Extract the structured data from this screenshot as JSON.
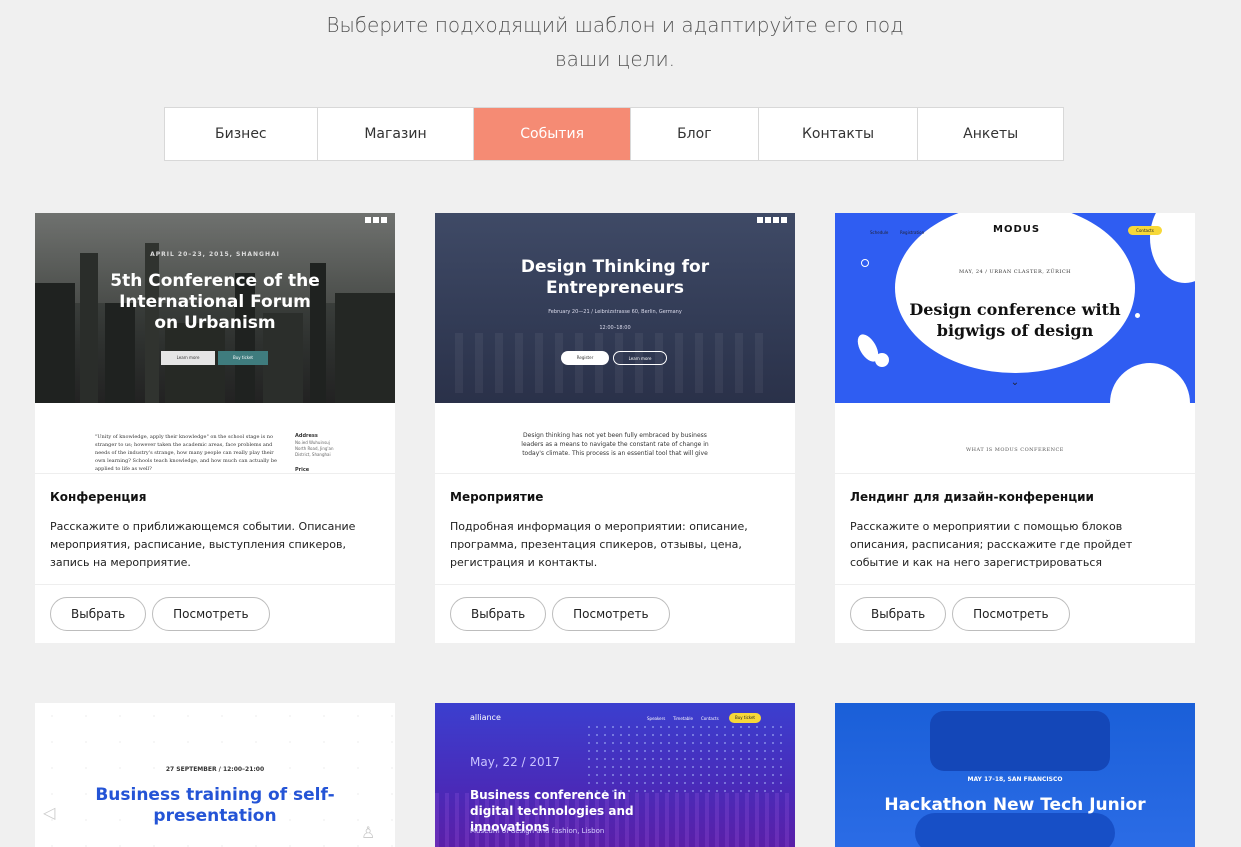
{
  "intro": {
    "line1": "Выберите подходящий шаблон и адаптируйте его под",
    "line2": "ваши цели."
  },
  "tabs": [
    {
      "label": "Бизнес",
      "active": false
    },
    {
      "label": "Магазин",
      "active": false
    },
    {
      "label": "События",
      "active": true
    },
    {
      "label": "Блог",
      "active": false
    },
    {
      "label": "Контакты",
      "active": false
    },
    {
      "label": "Анкеты",
      "active": false
    }
  ],
  "colors": {
    "accent": "#f58b74",
    "page_bg": "#f0f0f0",
    "modus_blue": "#2f5df2"
  },
  "cards": [
    {
      "title": "Конференция",
      "description": "Расскажите о приближающемся событии. Описание мероприятия, расписание, выступления спикеров, запись на мероприятие.",
      "select_label": "Выбрать",
      "view_label": "Посмотреть",
      "preview": {
        "date": "APRIL 20–23, 2015, SHANGHAI",
        "heading": "5th Conference of the International Forum on Urbanism",
        "btn1": "Learn more",
        "btn2": "Buy ticket",
        "quote": "\"Unity of knowledge, apply their knowledge\" on the school stage is no stranger to us; however taken the academic areas, face problems and needs of the industry's strange, how many people can really play their own learning? Schools teach knowledge, and how much can actually be applied to life as well?",
        "address_label": "Address",
        "address": "No.ied Wuhuinsuj North Road, Jing'an District, Shanghai",
        "price_label": "Price"
      }
    },
    {
      "title": "Мероприятие",
      "description": "Подробная информация о мероприятии: описание, программа, презентация спикеров, отзывы, цена, регистрация и контакты.",
      "select_label": "Выбрать",
      "view_label": "Посмотреть",
      "preview": {
        "heading": "Design Thinking for Entrepreneurs",
        "date": "February 20—21 / Leibnizstrasse 60, Berlin, Germany",
        "time": "12:00–18:00",
        "btn1": "Register",
        "btn2": "Learn more",
        "text": "Design thinking has not yet been fully embraced by business leaders as a means to navigate the constant rate of change in today's climate. This process is an essential tool that will give"
      }
    },
    {
      "title": "Лендинг для дизайн-конференции",
      "description": "Расскажите о мероприятии с помощью блоков описания, расписания; расскажите где пройдет событие и как на него зарегистрироваться",
      "select_label": "Выбрать",
      "view_label": "Посмотреть",
      "preview": {
        "nav1": "Schedule",
        "nav2": "Registration",
        "logo": "MODUS",
        "cta": "Contacts",
        "date": "MAY, 24 / URBAN CLASTER, ZÜRICH",
        "heading": "Design conference with bigwigs of design",
        "section": "WHAT IS MODUS CONFERENCE"
      }
    },
    {
      "preview": {
        "date": "27 SEPTEMBER / 12:00–21:00",
        "heading": "Business training of self-presentation"
      }
    },
    {
      "preview": {
        "logo": "alliance",
        "nav1": "Speakers",
        "nav2": "Timetable",
        "nav3": "Contacts",
        "cta": "Buy ticket",
        "date": "May, 22 / 2017",
        "heading": "Business conference in digital technologies and innovations",
        "sub": "Museum of design and fashion, Lisbon"
      }
    },
    {
      "preview": {
        "date": "MAY 17-18, SAN FRANCISCO",
        "heading": "Hackathon New Tech Junior"
      }
    }
  ]
}
